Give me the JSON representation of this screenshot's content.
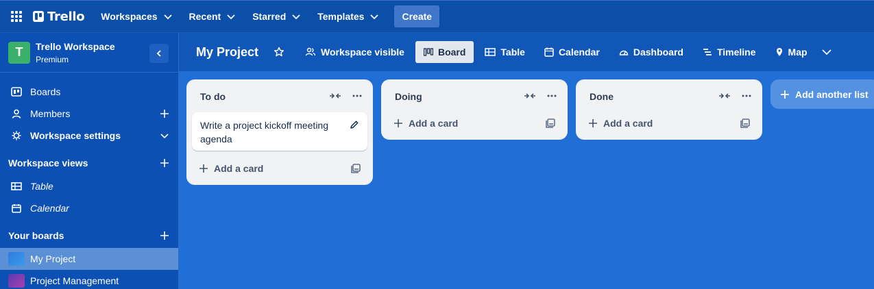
{
  "topnav": {
    "brand": "Trello",
    "menus": [
      {
        "label": "Workspaces"
      },
      {
        "label": "Recent"
      },
      {
        "label": "Starred"
      },
      {
        "label": "Templates"
      }
    ],
    "create_label": "Create"
  },
  "sidebar": {
    "workspace_initial": "T",
    "workspace_name": "Trello Workspace",
    "workspace_plan": "Premium",
    "items": [
      {
        "label": "Boards",
        "icon": "trello-board-icon"
      },
      {
        "label": "Members",
        "icon": "person-icon"
      },
      {
        "label": "Workspace settings",
        "icon": "gear-icon"
      }
    ],
    "views_heading": "Workspace views",
    "views": [
      {
        "label": "Table",
        "icon": "table-icon"
      },
      {
        "label": "Calendar",
        "icon": "calendar-icon"
      }
    ],
    "boards_heading": "Your boards",
    "boards": [
      {
        "label": "My Project",
        "color": "#2f7be0"
      },
      {
        "label": "Project Management",
        "color": "#7b3fb5"
      }
    ]
  },
  "board": {
    "title": "My Project",
    "visibility": "Workspace visible",
    "views": [
      {
        "label": "Board",
        "icon": "board-icon",
        "active": true
      },
      {
        "label": "Table",
        "icon": "table-icon"
      },
      {
        "label": "Calendar",
        "icon": "calendar-icon"
      },
      {
        "label": "Dashboard",
        "icon": "dashboard-icon"
      },
      {
        "label": "Timeline",
        "icon": "timeline-icon"
      },
      {
        "label": "Map",
        "icon": "map-pin-icon"
      }
    ]
  },
  "lists": [
    {
      "title": "To do",
      "cards": [
        "Write a project kickoff meeting agenda"
      ],
      "add_card": "Add a card"
    },
    {
      "title": "Doing",
      "cards": [],
      "add_card": "Add a card"
    },
    {
      "title": "Done",
      "cards": [],
      "add_card": "Add a card"
    }
  ],
  "add_list_label": "Add another list",
  "colors": {
    "nav_bg": "#0c4fa8",
    "sidebar_bg": "#0c50b4",
    "board_bg": "#1f6fd6",
    "list_bg": "#f1f2f4",
    "avatar": "#3ab06a"
  }
}
